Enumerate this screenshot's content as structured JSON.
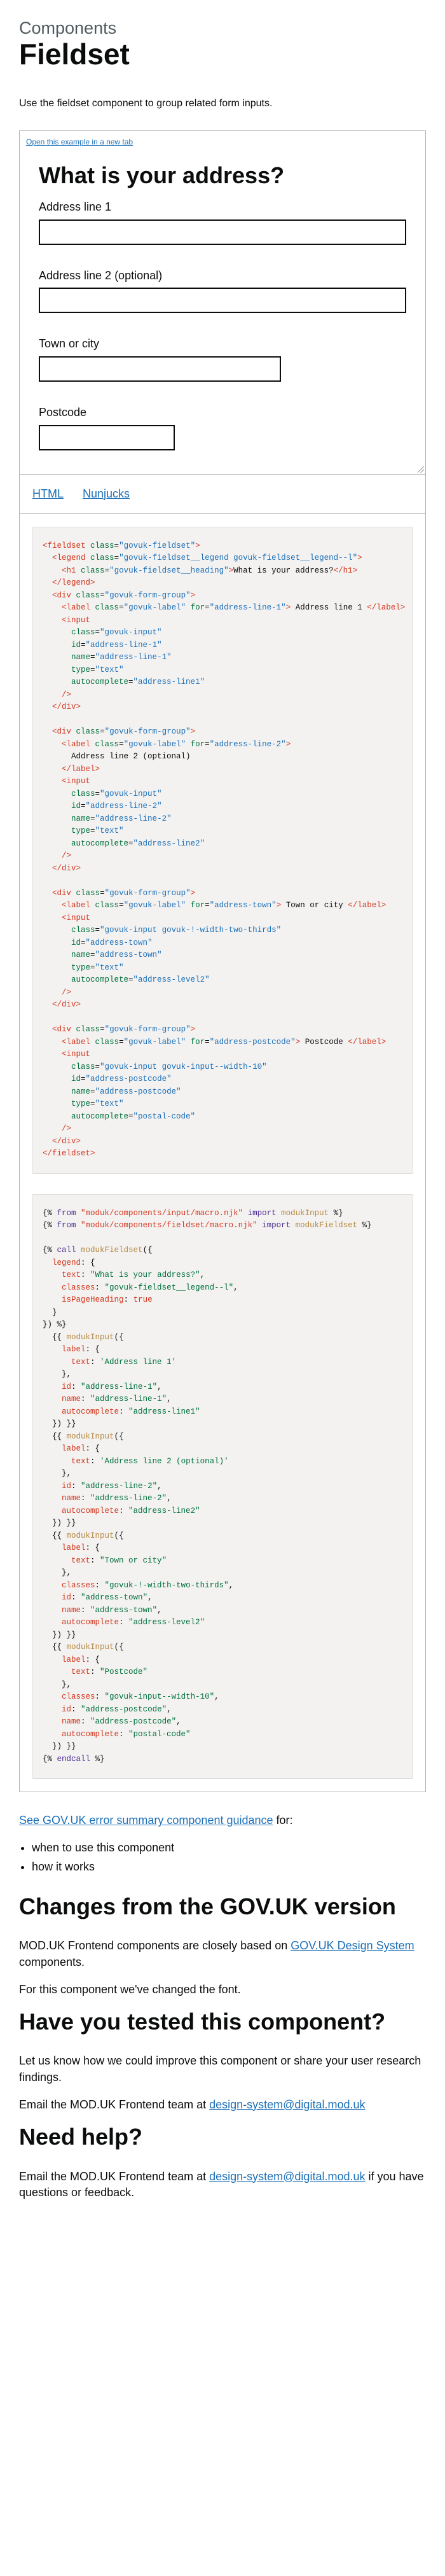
{
  "header": {
    "caption": "Components",
    "title": "Fieldset"
  },
  "lede": "Use the fieldset component to group related form inputs.",
  "example": {
    "open_link": "Open this example in a new tab",
    "heading": "What is your address?",
    "fields": {
      "line1_label": "Address line 1",
      "line1_value": "",
      "line2_label": "Address line 2 (optional)",
      "line2_value": "",
      "town_label": "Town or city",
      "town_value": "",
      "postcode_label": "Postcode",
      "postcode_value": ""
    }
  },
  "tabs": [
    {
      "label": "HTML"
    },
    {
      "label": "Nunjucks"
    }
  ],
  "guidance": {
    "link": "See GOV.UK error summary component guidance",
    "suffix": " for:",
    "bullets": [
      "when to use this component",
      "how it works"
    ]
  },
  "changes": {
    "heading": "Changes from the GOV.UK version",
    "para1_prefix": "MOD.UK Frontend components are closely based on ",
    "para1_link": "GOV.UK Design System",
    "para1_suffix": " components.",
    "para2": "For this component we've changed the font."
  },
  "tested": {
    "heading": "Have you tested this component?",
    "para1": "Let us know how we could improve this component or share your user research findings.",
    "para2_prefix": "Email the MOD.UK Frontend team at ",
    "email": "design-system@digital.mod.uk"
  },
  "help": {
    "heading": "Need help?",
    "para_prefix": "Email the MOD.UK Frontend team at ",
    "email": "design-system@digital.mod.uk",
    "para_suffix": " if you have questions or feedback."
  },
  "colors": {
    "link": "#1d70b8",
    "text": "#0b0c0c",
    "secondary_text": "#505a5f",
    "code_bg": "#f3f2f1",
    "border": "#b1b4b6"
  }
}
